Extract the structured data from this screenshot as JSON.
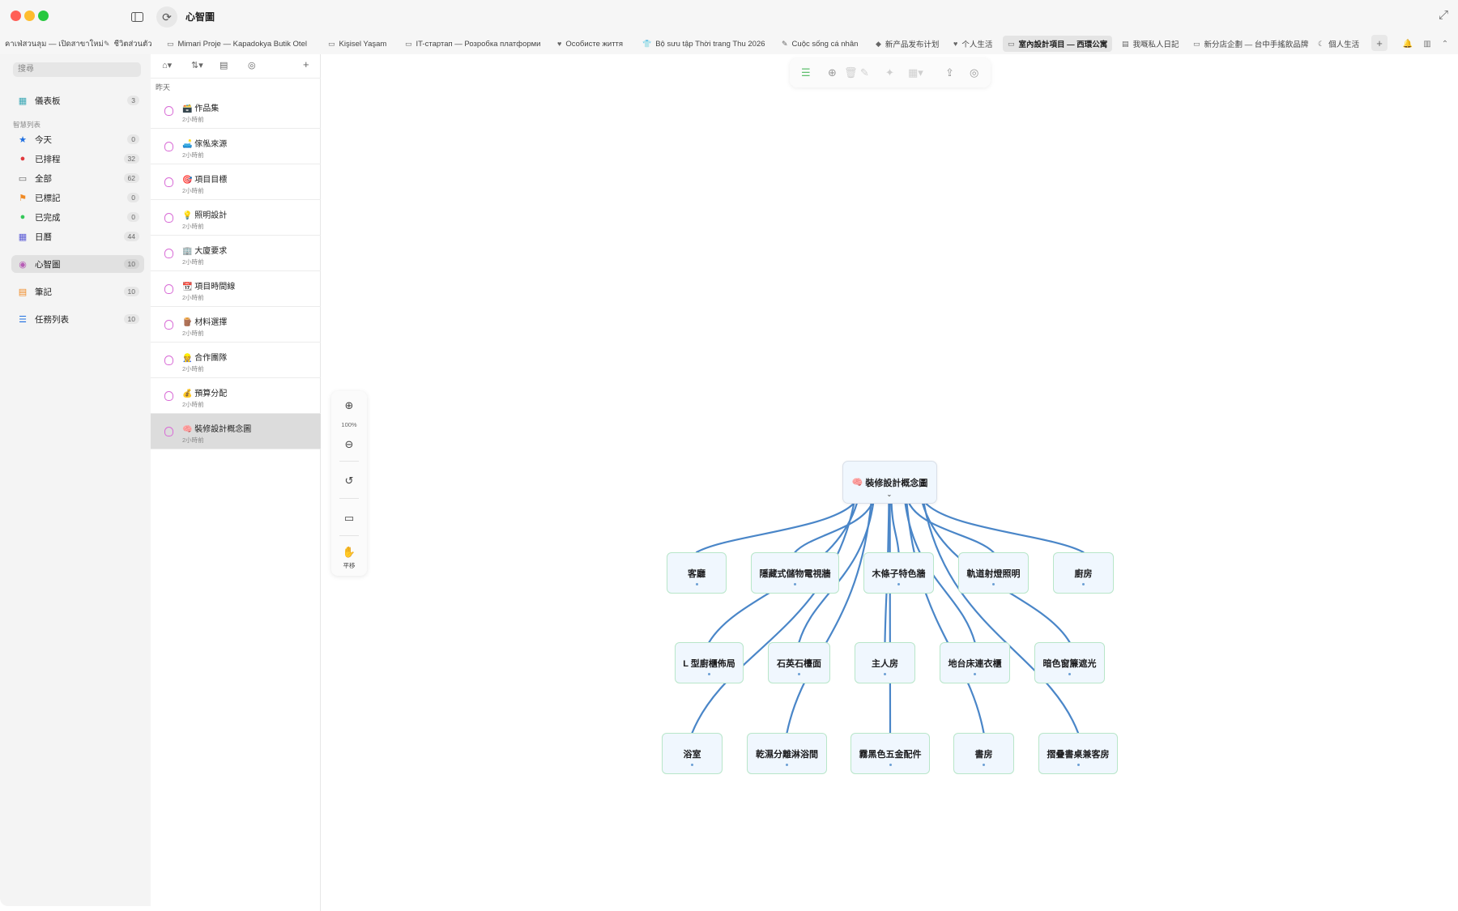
{
  "window": {
    "title": "心智圖"
  },
  "tabs": [
    {
      "label": "คาเฟ่สวนลุม — เปิดสาขาใหม่",
      "icon": "notes-icon"
    },
    {
      "label": "ชีวิตส่วนตัว",
      "icon": "note-icon"
    },
    {
      "label": "Mimari Proje — Kapadokya Butik Otel",
      "icon": "bed-icon"
    },
    {
      "label": "Kişisel Yaşam",
      "icon": "bed-icon"
    },
    {
      "label": "IT-стартап — Розробка платформи",
      "icon": "monitor-icon"
    },
    {
      "label": "Особисте життя",
      "icon": "heart-icon"
    },
    {
      "label": "Bộ sưu tập Thời trang Thu 2026",
      "icon": "shirt-icon"
    },
    {
      "label": "Cuộc sống cá nhân",
      "icon": "note-icon"
    },
    {
      "label": "新产品发布计划",
      "icon": "box-icon"
    },
    {
      "label": "个人生活",
      "icon": "heart-icon"
    },
    {
      "label": "室內設計項目 — 西環公寓",
      "icon": "sofa-icon",
      "active": true
    },
    {
      "label": "我嘅私人日記",
      "icon": "chart-icon"
    },
    {
      "label": "新分店企劃 — 台中手搖飲品牌",
      "icon": "cup-icon"
    },
    {
      "label": "個人生活",
      "icon": "moon-icon"
    }
  ],
  "sidebar": {
    "search_placeholder": "搜尋",
    "dashboard": {
      "label": "儀表板",
      "count": "3"
    },
    "section_label": "智慧列表",
    "smart_lists": [
      {
        "label": "今天",
        "count": "0",
        "icon": "star-icon",
        "color": "#1f6fe0"
      },
      {
        "label": "已排程",
        "count": "32",
        "icon": "clock-icon",
        "color": "#e0393e"
      },
      {
        "label": "全部",
        "count": "62",
        "icon": "tray-icon",
        "color": "#666666"
      },
      {
        "label": "已標記",
        "count": "0",
        "icon": "flag-icon",
        "color": "#f08a24"
      },
      {
        "label": "已完成",
        "count": "0",
        "icon": "check-circle-icon",
        "color": "#34c759"
      },
      {
        "label": "日曆",
        "count": "44",
        "icon": "calendar-icon",
        "color": "#5b5bd6"
      }
    ],
    "mindmap": {
      "label": "心智圖",
      "count": "10"
    },
    "notes": {
      "label": "筆記",
      "count": "10"
    },
    "tasks": {
      "label": "任務列表",
      "count": "10"
    }
  },
  "list": {
    "group": "昨天",
    "items": [
      {
        "emoji": "🗃️",
        "title": "作品集",
        "time": "2小時前"
      },
      {
        "emoji": "🛋️",
        "title": "傢俬來源",
        "time": "2小時前"
      },
      {
        "emoji": "🎯",
        "title": "項目目標",
        "time": "2小時前"
      },
      {
        "emoji": "💡",
        "title": "照明設計",
        "time": "2小時前"
      },
      {
        "emoji": "🏢",
        "title": "大廈要求",
        "time": "2小時前"
      },
      {
        "emoji": "📆",
        "title": "項目時間線",
        "time": "2小時前"
      },
      {
        "emoji": "🪵",
        "title": "材料選擇",
        "time": "2小時前"
      },
      {
        "emoji": "👷",
        "title": "合作團隊",
        "time": "2小時前"
      },
      {
        "emoji": "💰",
        "title": "預算分配",
        "time": "2小時前"
      },
      {
        "emoji": "🧠",
        "title": "裝修設計概念圖",
        "time": "2小時前",
        "selected": true
      }
    ]
  },
  "zoom": {
    "percent": "100%",
    "pan_label": "平移"
  },
  "mindmap": {
    "root": {
      "emoji": "🧠",
      "label": "裝修設計概念圖"
    },
    "nodes": [
      {
        "label": "客廳"
      },
      {
        "label": "隱藏式儲物電視牆"
      },
      {
        "label": "木條子特色牆"
      },
      {
        "label": "軌道射燈照明"
      },
      {
        "label": "廚房"
      },
      {
        "label": "L 型廚櫃佈局"
      },
      {
        "label": "石英石檯面"
      },
      {
        "label": "主人房"
      },
      {
        "label": "地台床連衣櫃"
      },
      {
        "label": "暗色窗簾遮光"
      },
      {
        "label": "浴室"
      },
      {
        "label": "乾濕分離淋浴間"
      },
      {
        "label": "霧黑色五金配件"
      },
      {
        "label": "書房"
      },
      {
        "label": "摺疊書桌兼客房"
      }
    ],
    "link_color": "#4a86c8"
  }
}
